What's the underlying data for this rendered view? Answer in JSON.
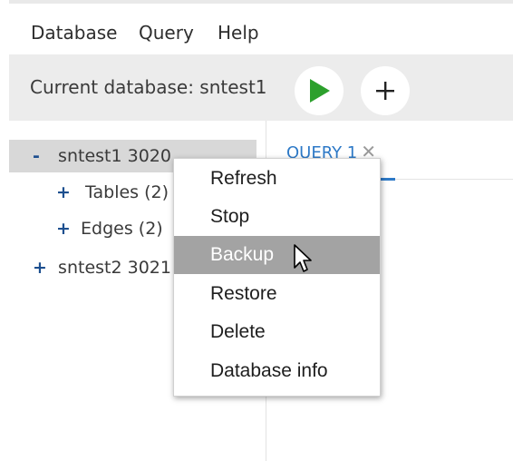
{
  "menubar": {
    "items": [
      "Database",
      "Query",
      "Help"
    ]
  },
  "toolbar": {
    "current_database_label": "Current database: sntest1",
    "run_icon": "play-icon",
    "add_icon": "plus-icon",
    "run_color": "#2ca02c"
  },
  "sidebar": {
    "tree": [
      {
        "toggle": "-",
        "label": "sntest1 3020",
        "selected": true
      },
      {
        "toggle": "+",
        "label": "Tables (2)"
      },
      {
        "toggle": "+",
        "label": "Edges (2)"
      },
      {
        "toggle": "+",
        "label": "sntest2 3021"
      }
    ]
  },
  "workspace": {
    "tabs": [
      {
        "label": "QUERY 1",
        "close_icon": "close-icon",
        "active": true
      }
    ]
  },
  "context_menu": {
    "items": [
      "Refresh",
      "Stop",
      "Backup",
      "Restore",
      "Delete",
      "Database info"
    ],
    "highlighted": "Backup"
  },
  "colors": {
    "accent": "#2d79c7",
    "tree_toggle": "#1d4f8f",
    "highlight": "#a3a3a3"
  }
}
